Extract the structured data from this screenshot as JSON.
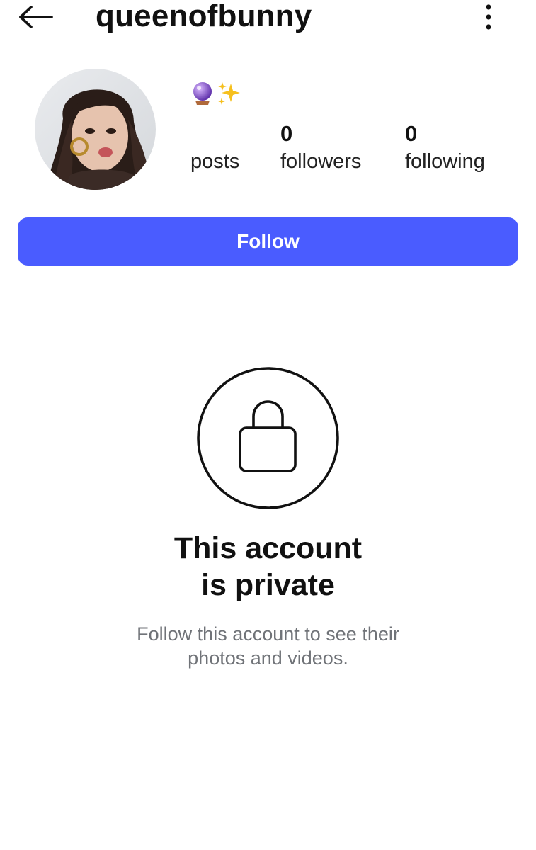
{
  "header": {
    "username": "queenofbunny",
    "back_icon": "arrow-left-icon",
    "more_icon": "more-vertical-icon"
  },
  "profile": {
    "avatar_icon": "profile-photo",
    "bio_emoji": [
      "crystal-ball-icon",
      "sparkles-icon"
    ],
    "stats": {
      "posts_count": "",
      "posts_label": "posts",
      "followers_count": "0",
      "followers_label": "followers",
      "following_count": "0",
      "following_label": "following"
    }
  },
  "actions": {
    "follow_label": "Follow"
  },
  "private_notice": {
    "icon": "lock-icon",
    "title_line1": "This account",
    "title_line2": "is private",
    "subtitle_line1": "Follow this account to see their",
    "subtitle_line2": "photos and videos."
  },
  "colors": {
    "accent": "#4a5cff",
    "text": "#111111",
    "muted": "#707378"
  }
}
